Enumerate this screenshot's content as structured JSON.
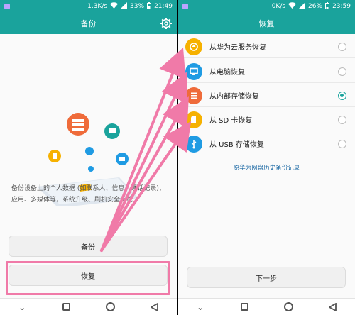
{
  "left": {
    "status": {
      "speed": "1.3K/s",
      "battery": "33%",
      "time": "21:49"
    },
    "title": "备份",
    "description": "备份设备上的个人数据 (如联系人、信息、通话记录)、应用、多媒体等，系统升级、刷机安全无忧",
    "backup_label": "备份",
    "restore_label": "恢复"
  },
  "right": {
    "status": {
      "speed": "0K/s",
      "battery": "26%",
      "time": "23:59"
    },
    "title": "恢复",
    "options": [
      {
        "label": "从华为云服务恢复",
        "color": "#f6b100",
        "icon": "cloud-icon",
        "selected": false
      },
      {
        "label": "从电脑恢复",
        "color": "#1f9be3",
        "icon": "monitor-icon",
        "selected": false
      },
      {
        "label": "从内部存储恢复",
        "color": "#ef6b3a",
        "icon": "storage-icon",
        "selected": true
      },
      {
        "label": "从 SD 卡恢复",
        "color": "#f6b100",
        "icon": "sd-card-icon",
        "selected": false
      },
      {
        "label": "从 USB 存储恢复",
        "color": "#1f9be3",
        "icon": "usb-icon",
        "selected": false
      }
    ],
    "history_link": "原华为网盘历史备份记录",
    "next_label": "下一步"
  },
  "colors": {
    "accent": "#1aa39c",
    "highlight": "#f07aa8",
    "arrow": "#f07aa8"
  }
}
